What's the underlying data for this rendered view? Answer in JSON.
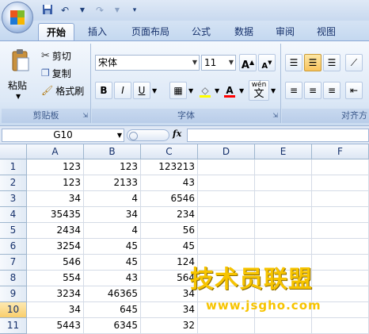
{
  "ribbon": {
    "tabs": [
      "开始",
      "插入",
      "页面布局",
      "公式",
      "数据",
      "审阅",
      "视图"
    ],
    "active_tab": "开始",
    "clipboard": {
      "paste": "粘贴",
      "cut": "剪切",
      "copy": "复制",
      "format_painter": "格式刷",
      "label": "剪贴板"
    },
    "font": {
      "name": "宋体",
      "size": "11",
      "bold": "B",
      "italic": "I",
      "underline": "U",
      "label": "字体",
      "grow": "A",
      "shrink": "A",
      "font_color": "A",
      "fill_color": "◇",
      "phonetic": "wén"
    },
    "alignment": {
      "label": "对齐方"
    }
  },
  "formula_bar": {
    "name_box": "G10",
    "fx": "fx",
    "value": ""
  },
  "sheet": {
    "columns": [
      "A",
      "B",
      "C",
      "D",
      "E",
      "F"
    ],
    "rows": [
      {
        "n": "1",
        "a": "123",
        "b": "123",
        "c": "123213"
      },
      {
        "n": "2",
        "a": "123",
        "b": "2133",
        "c": "43"
      },
      {
        "n": "3",
        "a": "34",
        "b": "4",
        "c": "6546"
      },
      {
        "n": "4",
        "a": "35435",
        "b": "34",
        "c": "234"
      },
      {
        "n": "5",
        "a": "2434",
        "b": "4",
        "c": "56"
      },
      {
        "n": "6",
        "a": "3254",
        "b": "45",
        "c": "45"
      },
      {
        "n": "7",
        "a": "546",
        "b": "45",
        "c": "124"
      },
      {
        "n": "8",
        "a": "554",
        "b": "43",
        "c": "564"
      },
      {
        "n": "9",
        "a": "3234",
        "b": "46365",
        "c": "34"
      },
      {
        "n": "10",
        "a": "34",
        "b": "645",
        "c": "34"
      },
      {
        "n": "11",
        "a": "5443",
        "b": "6345",
        "c": "32"
      }
    ],
    "active_row": "10"
  },
  "watermark": {
    "text": "技术员联盟",
    "url": "www.jsgho.com"
  }
}
